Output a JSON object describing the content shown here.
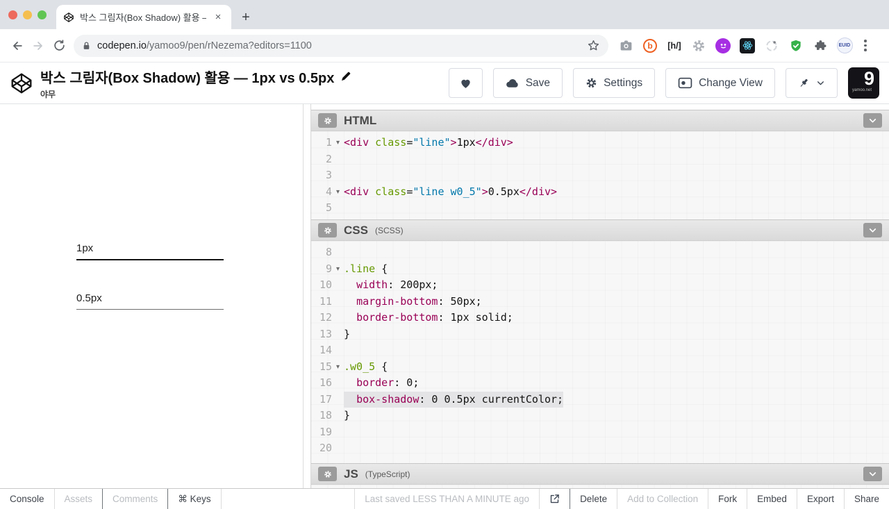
{
  "browser": {
    "tab": {
      "title": "박스 그림자(Box Shadow) 활용 —",
      "close_glyph": "×",
      "new_tab_glyph": "+"
    },
    "url_bar": {
      "domain": "codepen.io",
      "path": "/yamoo9/pen/rNezema?editors=1100"
    },
    "extension_icons": [
      "bookmark-star-icon",
      "camera-icon",
      "bitly-icon",
      "h-brackets-icon",
      "gear-extension-icon",
      "purple-assistant-icon",
      "react-devtools-icon",
      "lighthouse-icon",
      "shield-check-icon",
      "puzzle-extension-icon",
      "euid-icon",
      "browser-menu-icon"
    ],
    "extension_glyphs": {
      "bitly": "b",
      "h_brackets": "[h/]",
      "euid": "EUID"
    }
  },
  "pen_header": {
    "title": "박스 그림자(Box Shadow) 활용 — 1px vs 0.5px",
    "author": "야무",
    "buttons": {
      "save": "Save",
      "settings": "Settings",
      "change_view": "Change View"
    },
    "avatar": {
      "glyph": "9",
      "label": "yamoo.net"
    }
  },
  "preview": {
    "items": [
      {
        "label": "1px"
      },
      {
        "label": "0.5px"
      }
    ]
  },
  "editors": [
    {
      "title": "HTML",
      "preprocessor": "",
      "lines": [
        {
          "num": "1",
          "fold": true,
          "tokens": [
            [
              "tag",
              "<div "
            ],
            [
              "attr",
              "class"
            ],
            [
              "plain",
              "="
            ],
            [
              "string",
              "\"line\""
            ],
            [
              "tag",
              ">"
            ],
            [
              "plain",
              "1px"
            ],
            [
              "tag",
              "</div>"
            ]
          ]
        },
        {
          "num": "2",
          "tokens": []
        },
        {
          "num": "3",
          "tokens": []
        },
        {
          "num": "4",
          "fold": true,
          "tokens": [
            [
              "tag",
              "<div "
            ],
            [
              "attr",
              "class"
            ],
            [
              "plain",
              "="
            ],
            [
              "string",
              "\"line w0_5\""
            ],
            [
              "tag",
              ">"
            ],
            [
              "plain",
              "0.5px"
            ],
            [
              "tag",
              "</div>"
            ]
          ]
        },
        {
          "num": "5",
          "tokens": []
        }
      ]
    },
    {
      "title": "CSS",
      "preprocessor": "(SCSS)",
      "lines": [
        {
          "num": "8",
          "tokens": []
        },
        {
          "num": "9",
          "fold": true,
          "tokens": [
            [
              "sel",
              ".line"
            ],
            [
              "plain",
              " {"
            ]
          ]
        },
        {
          "num": "10",
          "tokens": [
            [
              "plain",
              "  "
            ],
            [
              "prop",
              "width"
            ],
            [
              "plain",
              ": 200px;"
            ]
          ]
        },
        {
          "num": "11",
          "tokens": [
            [
              "plain",
              "  "
            ],
            [
              "prop",
              "margin-bottom"
            ],
            [
              "plain",
              ": 50px;"
            ]
          ]
        },
        {
          "num": "12",
          "tokens": [
            [
              "plain",
              "  "
            ],
            [
              "prop",
              "border-bottom"
            ],
            [
              "plain",
              ": 1px solid;"
            ]
          ]
        },
        {
          "num": "13",
          "tokens": [
            [
              "plain",
              "}"
            ]
          ]
        },
        {
          "num": "14",
          "tokens": []
        },
        {
          "num": "15",
          "fold": true,
          "tokens": [
            [
              "sel",
              ".w0_5"
            ],
            [
              "plain",
              " {"
            ]
          ]
        },
        {
          "num": "16",
          "tokens": [
            [
              "plain",
              "  "
            ],
            [
              "prop",
              "border"
            ],
            [
              "plain",
              ": 0;"
            ]
          ]
        },
        {
          "num": "17",
          "highlight": true,
          "tokens": [
            [
              "plain",
              "  "
            ],
            [
              "prop",
              "box-shadow"
            ],
            [
              "plain",
              ": 0 0.5px currentColor;"
            ]
          ]
        },
        {
          "num": "18",
          "tokens": [
            [
              "plain",
              "}"
            ]
          ]
        },
        {
          "num": "19",
          "tokens": []
        },
        {
          "num": "20",
          "tokens": []
        }
      ]
    },
    {
      "title": "JS",
      "preprocessor": "(TypeScript)",
      "lines": []
    }
  ],
  "syntax": {
    "tag": "#990055",
    "attribute": "#669900",
    "string": "#0077aa",
    "property": "#990055",
    "selector": "#669900",
    "plain": "#141414",
    "line_number": "#a8a8a8"
  },
  "footer": {
    "left": [
      "Console",
      "Assets",
      "Comments",
      "⌘ Keys"
    ],
    "last_saved": "Last saved LESS THAN A MINUTE ago",
    "right": [
      "Delete",
      "Add to Collection",
      "Fork",
      "Embed",
      "Export",
      "Share"
    ]
  }
}
